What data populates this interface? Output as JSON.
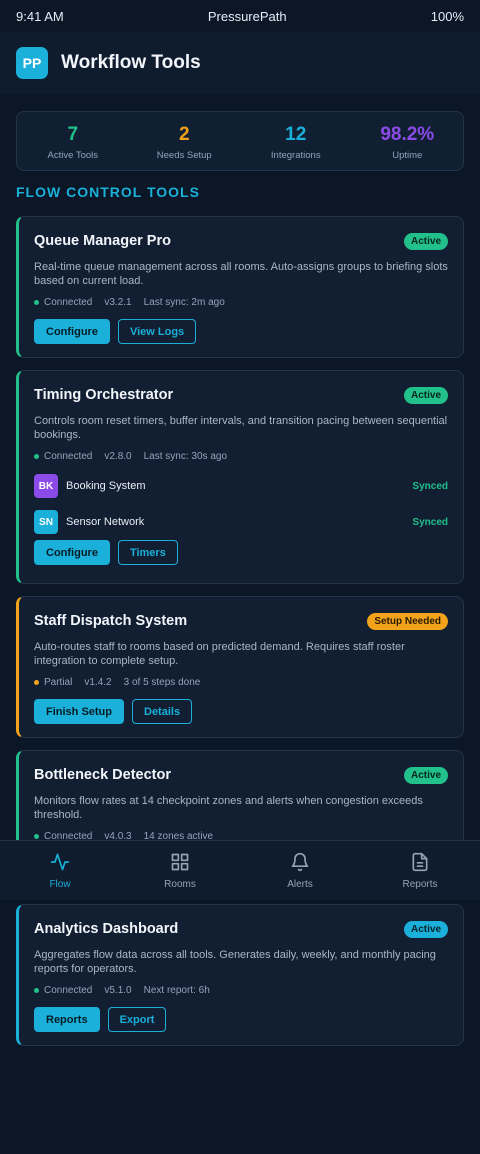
{
  "status_bar": {
    "time": "9:41 AM",
    "app_name": "PressurePath",
    "battery": "100%"
  },
  "header": {
    "logo": "PP",
    "title": "Workflow Tools"
  },
  "stats": [
    {
      "value": "7",
      "label": "Active Tools",
      "color": "#22c08a"
    },
    {
      "value": "2",
      "label": "Needs Setup",
      "color": "#f2a31b"
    },
    {
      "value": "12",
      "label": "Integrations",
      "color": "#1ab0d9"
    },
    {
      "value": "98.2%",
      "label": "Uptime",
      "color": "#8b4be8"
    }
  ],
  "section_title": "FLOW CONTROL TOOLS",
  "cards": [
    {
      "title": "Queue Manager Pro",
      "badge": "Active",
      "desc": "Real-time queue management across all rooms. Auto-assigns groups to briefing slots based on current load.",
      "meta": [
        "Connected",
        "v3.2.1",
        "Last sync: 2m ago"
      ],
      "buttons": [
        "Configure",
        "View Logs"
      ]
    },
    {
      "title": "Timing Orchestrator",
      "badge": "Active",
      "desc": "Controls room reset timers, buffer intervals, and transition pacing between sequential bookings.",
      "meta": [
        "Connected",
        "v2.8.0",
        "Last sync: 30s ago"
      ],
      "integrations": [
        {
          "icon": "BK",
          "name": "Booking System",
          "status": "Synced",
          "color": "#8b4be8"
        },
        {
          "icon": "SN",
          "name": "Sensor Network",
          "status": "Synced",
          "color": "#1ab0d9"
        }
      ],
      "buttons": [
        "Configure",
        "Timers"
      ]
    },
    {
      "title": "Staff Dispatch System",
      "badge": "Setup Needed",
      "desc": "Auto-routes staff to rooms based on predicted demand. Requires staff roster integration to complete setup.",
      "meta": [
        "Partial",
        "v1.4.2",
        "3 of 5 steps done"
      ],
      "buttons": [
        "Finish Setup",
        "Details"
      ]
    },
    {
      "title": "Bottleneck Detector",
      "badge": "Active",
      "desc": "Monitors flow rates at 14 checkpoint zones and alerts when congestion exceeds threshold.",
      "meta": [
        "Connected",
        "v4.0.3",
        "14 zones active"
      ]
    },
    {
      "title": "Analytics Dashboard",
      "badge": "Active",
      "desc": "Aggregates flow data across all tools. Generates daily, weekly, and monthly pacing reports for operators.",
      "meta": [
        "Connected",
        "v5.1.0",
        "Next report: 6h"
      ],
      "buttons": [
        "Reports",
        "Export"
      ]
    }
  ],
  "nav": [
    {
      "label": "Flow",
      "icon": "activity-icon"
    },
    {
      "label": "Rooms",
      "icon": "grid-icon"
    },
    {
      "label": "Alerts",
      "icon": "bell-icon"
    },
    {
      "label": "Reports",
      "icon": "document-icon"
    }
  ],
  "colors": {
    "accent": "#1ab0d9",
    "success": "#22c08a",
    "warning": "#f2a31b",
    "purple": "#8b4be8",
    "background": "#0b1626"
  }
}
